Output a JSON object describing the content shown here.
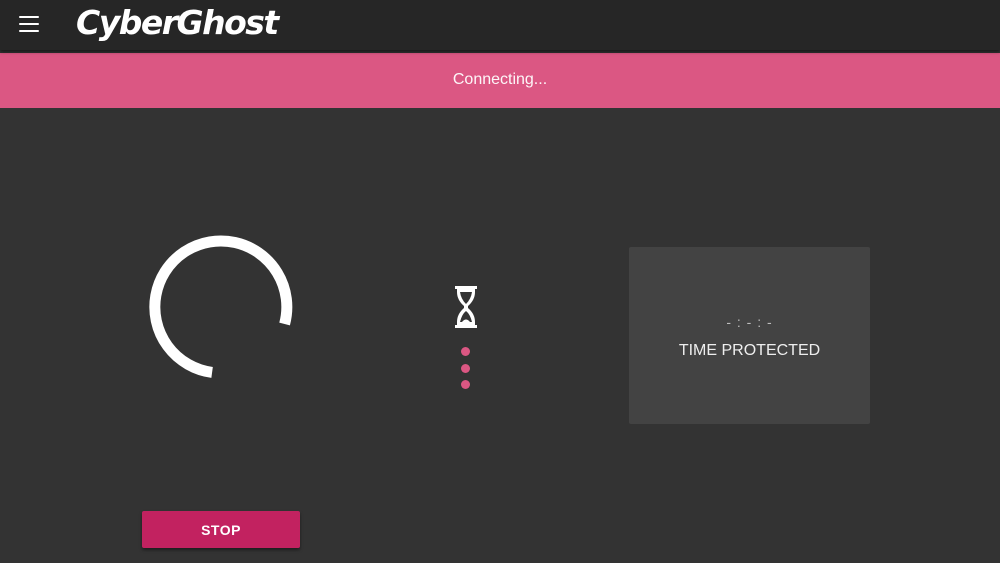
{
  "header": {
    "app_name": "CyberGhost",
    "menu_icon": "hamburger-menu-icon"
  },
  "status": {
    "text": "Connecting...",
    "color": "#db5783"
  },
  "progress": {
    "icon": "loading-spinner-icon",
    "connecting_icon": "hourglass-icon"
  },
  "time_panel": {
    "value": "- : - : -",
    "label": "TIME PROTECTED"
  },
  "actions": {
    "stop_label": "STOP",
    "stop_color": "#c22260"
  }
}
